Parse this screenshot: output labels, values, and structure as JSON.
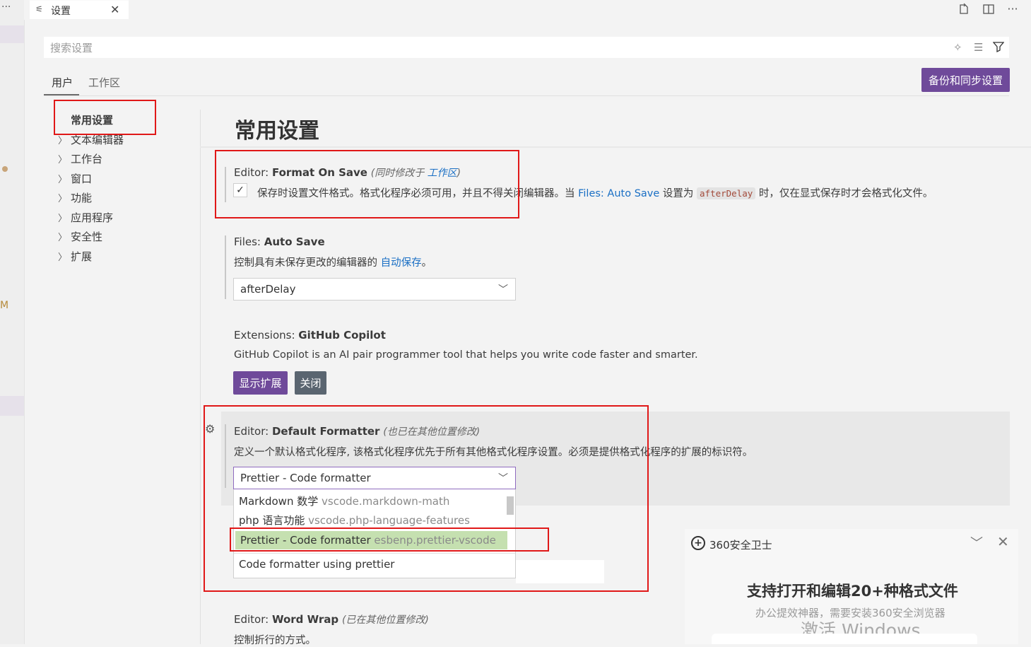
{
  "activity": {
    "dots": "···",
    "badge": "M"
  },
  "tab": {
    "icon": "settings-icon",
    "label": "设置",
    "close": "✕"
  },
  "search": {
    "placeholder": "搜索设置"
  },
  "scopes": {
    "user": "用户",
    "workspace": "工作区"
  },
  "backup_button": "备份和同步设置",
  "toc": [
    {
      "label": "常用设置",
      "expandable": false
    },
    {
      "label": "文本编辑器",
      "expandable": true
    },
    {
      "label": "工作台",
      "expandable": true
    },
    {
      "label": "窗口",
      "expandable": true
    },
    {
      "label": "功能",
      "expandable": true
    },
    {
      "label": "应用程序",
      "expandable": true
    },
    {
      "label": "安全性",
      "expandable": true
    },
    {
      "label": "扩展",
      "expandable": true
    }
  ],
  "main": {
    "heading": "常用设置",
    "format_on_save": {
      "category": "Editor: ",
      "name": "Format On Save",
      "note_prefix": "(同时修改于 ",
      "note_link": "工作区",
      "note_suffix": ")",
      "checked": true,
      "desc_1": "保存时设置文件格式。格式化程序必须可用，并且不得关闭编辑器。当 ",
      "desc_link": "Files: Auto Save",
      "desc_2": " 设置为 ",
      "desc_code": "afterDelay",
      "desc_3": " 时，仅在显式保存时才会格式化文件。"
    },
    "auto_save": {
      "category": "Files: ",
      "name": "Auto Save",
      "desc_1": "控制具有未保存更改的编辑器的 ",
      "desc_link": "自动保存",
      "desc_2": "。",
      "value": "afterDelay"
    },
    "copilot": {
      "category": "Extensions: ",
      "name": "GitHub Copilot",
      "desc": "GitHub Copilot is an AI pair programmer tool that helps you write code faster and smarter.",
      "show_button": "显示扩展",
      "close_button": "关闭"
    },
    "default_formatter": {
      "category": "Editor: ",
      "name": "Default Formatter",
      "note": "(也已在其他位置修改)",
      "desc": "定义一个默认格式化程序, 该格式化程序优先于所有其他格式化程序设置。必须是提供格式化程序的扩展的标识符。",
      "value": "Prettier - Code formatter",
      "options": [
        {
          "label": "Markdown 数学",
          "id": "vscode.markdown-math",
          "selected": false
        },
        {
          "label": "php 语言功能",
          "id": "vscode.php-language-features",
          "selected": false
        },
        {
          "label": "Prettier - Code formatter",
          "id": "esbenp.prettier-vscode",
          "selected": true
        }
      ],
      "option_description": "Code formatter using prettier"
    },
    "word_wrap": {
      "category": "Editor: ",
      "name": "Word Wrap",
      "note": "(已在其他位置修改)",
      "desc": "控制折行的方式。"
    }
  },
  "popup": {
    "title": "360安全卫士",
    "headline": "支持打开和编辑20+种格式文件",
    "subline": "办公提效神器，需要安装360安全浏览器",
    "watermark": "激活 Windows"
  },
  "colors": {
    "accent": "#6f4a9a",
    "annotation_box": "#e01818",
    "selected_option": "#c5e0b0",
    "link": "#1a6fc4"
  }
}
